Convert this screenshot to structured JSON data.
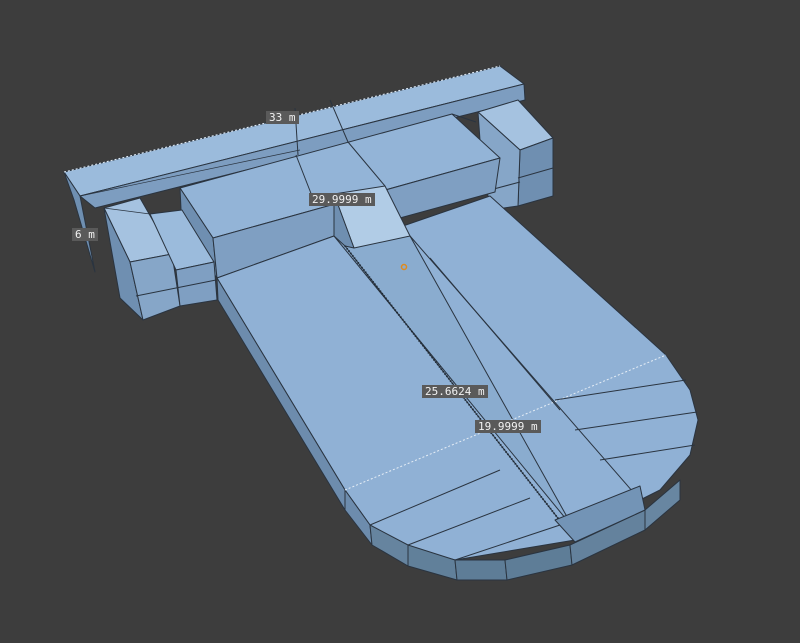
{
  "viewport": {
    "background": "#3d3d3d",
    "mesh_face_color": "#8fb0d3",
    "mesh_edge_color": "#2a3440",
    "origin_marker_color": "#e08a1c"
  },
  "dimensions": {
    "top_wall_length": "33 m",
    "wall_height": "6 m",
    "inner_width": "29.9999 m",
    "ramp_length": "25.6624 m",
    "platform_width": "19.9999 m"
  }
}
